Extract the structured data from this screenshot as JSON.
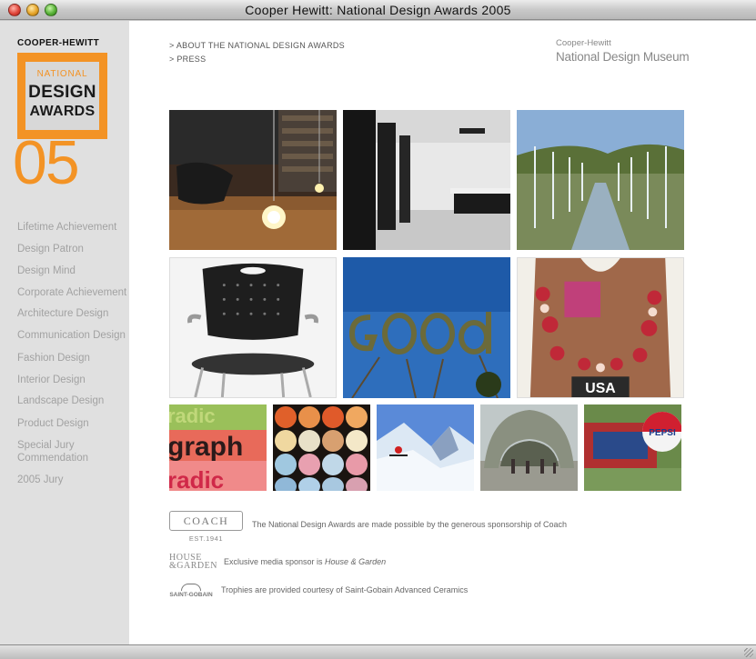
{
  "window": {
    "title": "Cooper Hewitt: National Design Awards 2005"
  },
  "sidebar": {
    "brand": "COOPER-HEWITT",
    "logo": {
      "line1": "NATIONAL",
      "line2": "DESIGN",
      "line3": "AWARDS",
      "year": "05"
    },
    "nav": [
      {
        "label": "Lifetime Achievement"
      },
      {
        "label": "Design Patron"
      },
      {
        "label": "Design Mind"
      },
      {
        "label": "Corporate Achievement"
      },
      {
        "label": "Architecture Design"
      },
      {
        "label": "Communication Design"
      },
      {
        "label": "Fashion Design"
      },
      {
        "label": "Interior Design"
      },
      {
        "label": "Landscape Design"
      },
      {
        "label": "Product Design"
      },
      {
        "label": "Special Jury"
      },
      {
        "label": "Commendation"
      },
      {
        "label": "2005 Jury"
      }
    ]
  },
  "header": {
    "links": [
      "> ABOUT THE NATIONAL DESIGN AWARDS",
      "> PRESS"
    ],
    "museum_small": "Cooper-Hewitt",
    "museum_large": "National Design Museum"
  },
  "gallery": {
    "tiles": [
      {
        "name": "photo-interior-lamp"
      },
      {
        "name": "photo-architecture-corridor"
      },
      {
        "name": "photo-landscape-fountains"
      },
      {
        "name": "photo-product-chair"
      },
      {
        "name": "photo-communication-good"
      },
      {
        "name": "photo-fashion-garment"
      },
      {
        "name": "photo-graphic-type"
      },
      {
        "name": "photo-pattern-bubbles"
      },
      {
        "name": "photo-snow-climber"
      },
      {
        "name": "photo-cloud-gate"
      },
      {
        "name": "photo-pepsi-graffiti"
      }
    ]
  },
  "sponsors": {
    "coach_logo": "COACH",
    "coach_est": "EST.1941",
    "coach_text": "The National Design Awards are made possible by the generous sponsorship of Coach",
    "hg_logo_top": "HOUSE",
    "hg_logo_bottom": "&GARDEN",
    "hg_text_prefix": "Exclusive media sponsor is ",
    "hg_text_italic": "House & Garden",
    "sg_logo": "SAINT-GOBAIN",
    "sg_text": "Trophies are provided courtesy of Saint-Gobain Advanced Ceramics"
  },
  "colors": {
    "accent": "#f39325",
    "sidebar_bg": "#e0e0e0",
    "nav_text": "#a2a2a2"
  }
}
